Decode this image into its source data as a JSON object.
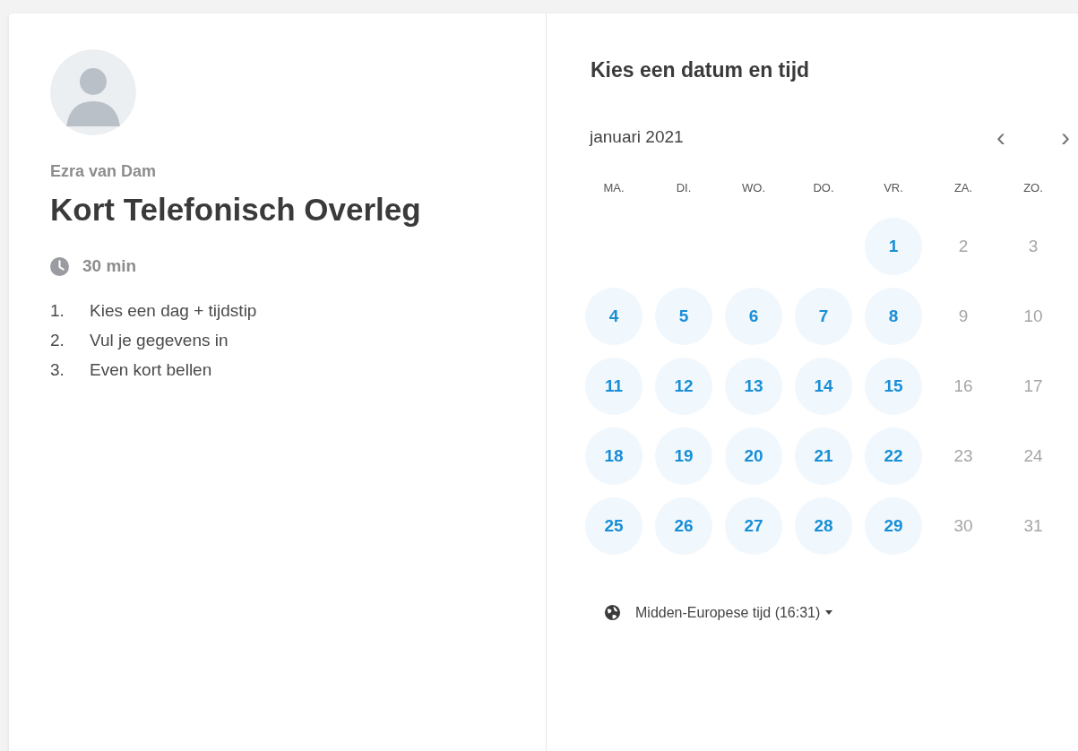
{
  "host": {
    "name": "Ezra van Dam"
  },
  "event": {
    "title": "Kort Telefonisch Overleg",
    "duration": "30 min",
    "steps": [
      {
        "number": "1.",
        "text": "Kies een dag + tijdstip"
      },
      {
        "number": "2.",
        "text": "Vul je gegevens in"
      },
      {
        "number": "3.",
        "text": "Even kort bellen"
      }
    ]
  },
  "calendar": {
    "heading": "Kies een datum en tijd",
    "month": "januari 2021",
    "prev_arrow": "‹",
    "next_arrow": "›",
    "weekdays": [
      "MA.",
      "DI.",
      "WO.",
      "DO.",
      "VR.",
      "ZA.",
      "ZO."
    ],
    "weeks": [
      [
        {
          "kind": "empty"
        },
        {
          "kind": "empty"
        },
        {
          "kind": "empty"
        },
        {
          "kind": "empty"
        },
        {
          "kind": "day",
          "label": "1",
          "available": true
        },
        {
          "kind": "day",
          "label": "2",
          "available": false
        },
        {
          "kind": "day",
          "label": "3",
          "available": false
        }
      ],
      [
        {
          "kind": "day",
          "label": "4",
          "available": true
        },
        {
          "kind": "day",
          "label": "5",
          "available": true
        },
        {
          "kind": "day",
          "label": "6",
          "available": true
        },
        {
          "kind": "day",
          "label": "7",
          "available": true
        },
        {
          "kind": "day",
          "label": "8",
          "available": true
        },
        {
          "kind": "day",
          "label": "9",
          "available": false
        },
        {
          "kind": "day",
          "label": "10",
          "available": false
        }
      ],
      [
        {
          "kind": "day",
          "label": "11",
          "available": true
        },
        {
          "kind": "day",
          "label": "12",
          "available": true
        },
        {
          "kind": "day",
          "label": "13",
          "available": true
        },
        {
          "kind": "day",
          "label": "14",
          "available": true
        },
        {
          "kind": "day",
          "label": "15",
          "available": true
        },
        {
          "kind": "day",
          "label": "16",
          "available": false
        },
        {
          "kind": "day",
          "label": "17",
          "available": false
        }
      ],
      [
        {
          "kind": "day",
          "label": "18",
          "available": true
        },
        {
          "kind": "day",
          "label": "19",
          "available": true
        },
        {
          "kind": "day",
          "label": "20",
          "available": true
        },
        {
          "kind": "day",
          "label": "21",
          "available": true
        },
        {
          "kind": "day",
          "label": "22",
          "available": true
        },
        {
          "kind": "day",
          "label": "23",
          "available": false
        },
        {
          "kind": "day",
          "label": "24",
          "available": false
        }
      ],
      [
        {
          "kind": "day",
          "label": "25",
          "available": true
        },
        {
          "kind": "day",
          "label": "26",
          "available": true
        },
        {
          "kind": "day",
          "label": "27",
          "available": true
        },
        {
          "kind": "day",
          "label": "28",
          "available": true
        },
        {
          "kind": "day",
          "label": "29",
          "available": true
        },
        {
          "kind": "day",
          "label": "30",
          "available": false
        },
        {
          "kind": "day",
          "label": "31",
          "available": false
        }
      ]
    ],
    "timezone": "Midden-Europese tijd (16:31)"
  }
}
